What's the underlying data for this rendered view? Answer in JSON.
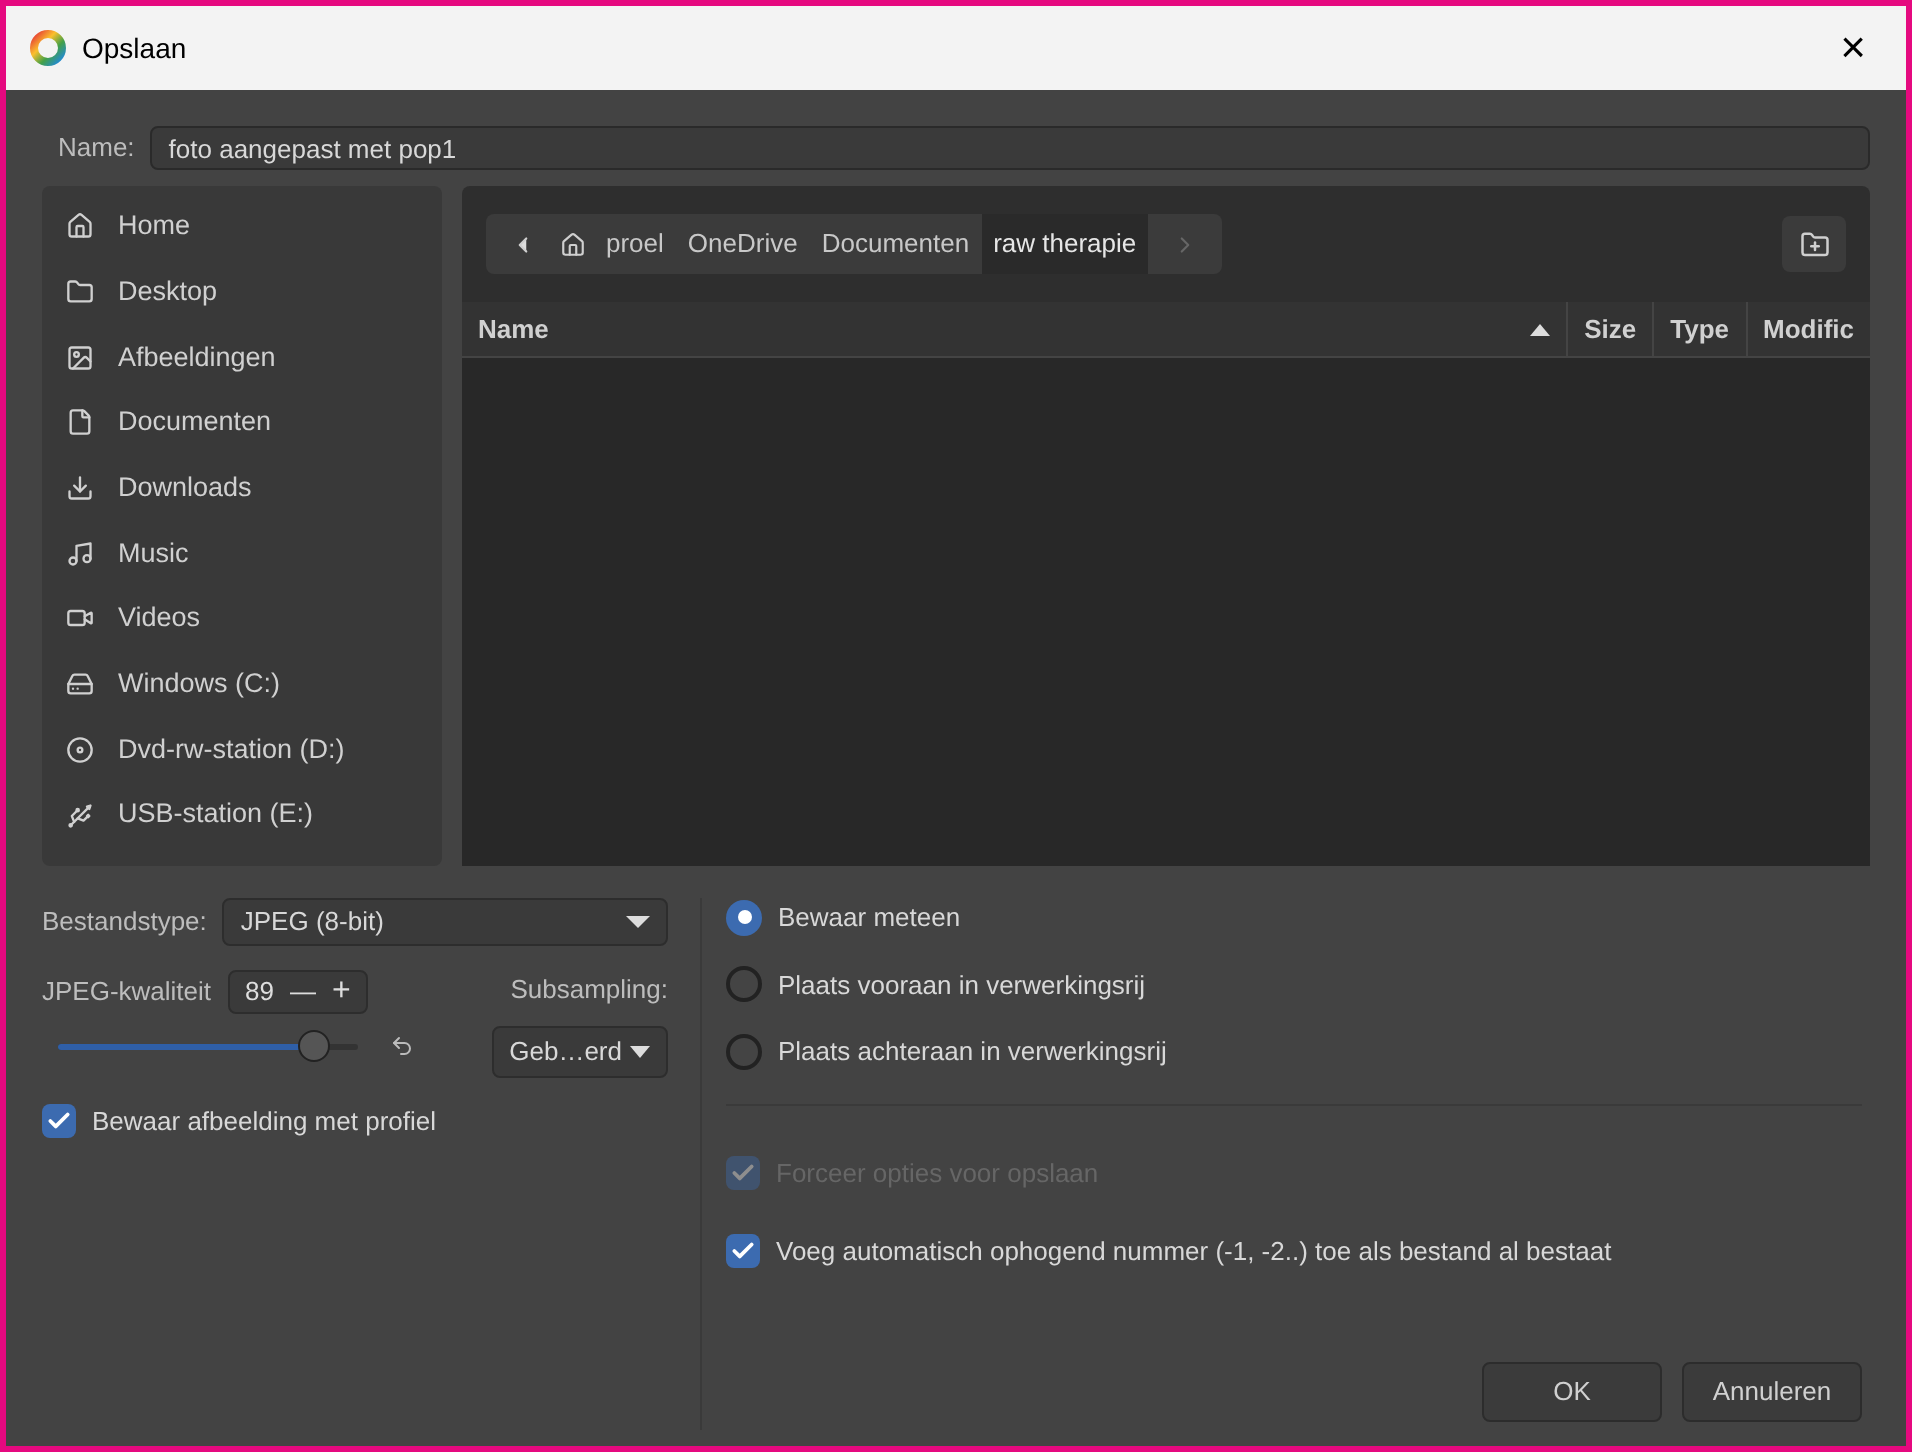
{
  "window": {
    "title": "Opslaan",
    "close": "×"
  },
  "name_field": {
    "label": "Name:",
    "value": "foto aangepast met pop1"
  },
  "places": [
    {
      "label": "Home",
      "kind": "home"
    },
    {
      "label": "Desktop",
      "kind": "folder"
    },
    {
      "label": "Afbeeldingen",
      "kind": "image"
    },
    {
      "label": "Documenten",
      "kind": "document"
    },
    {
      "label": "Downloads",
      "kind": "download"
    },
    {
      "label": "Music",
      "kind": "music"
    },
    {
      "label": "Videos",
      "kind": "video"
    },
    {
      "label": "Windows (C:)",
      "kind": "disk"
    },
    {
      "label": "Dvd-rw-station (D:)",
      "kind": "dvd"
    },
    {
      "label": "USB-station (E:)",
      "kind": "usb"
    }
  ],
  "breadcrumbs": [
    {
      "label": "proel",
      "selected": false
    },
    {
      "label": "OneDrive",
      "selected": false
    },
    {
      "label": "Documenten",
      "selected": false
    },
    {
      "label": "raw therapie",
      "selected": true
    }
  ],
  "table": {
    "columns": [
      {
        "label": "Name",
        "sorted": true
      },
      {
        "label": "Size",
        "sorted": false
      },
      {
        "label": "Type",
        "sorted": false
      },
      {
        "label": "Modific",
        "sorted": false
      }
    ]
  },
  "filetype": {
    "label": "Bestandstype:",
    "value": "JPEG (8-bit)"
  },
  "quality": {
    "label": "JPEG-kwaliteit",
    "value": "89",
    "minus": "—",
    "plus": "+",
    "level": 0.85
  },
  "subsampling": {
    "label": "Subsampling:",
    "value": "Geb…erd"
  },
  "profile_checkbox": {
    "label": "Bewaar afbeelding met profiel",
    "checked": true
  },
  "save_modes": [
    {
      "label": "Bewaar meteen",
      "selected": true
    },
    {
      "label": "Plaats vooraan in verwerkingsrij",
      "selected": false
    },
    {
      "label": "Plaats achteraan in verwerkingsrij",
      "selected": false
    }
  ],
  "options": [
    {
      "label": "Forceer opties voor opslaan",
      "checked": true,
      "disabled": true
    },
    {
      "label": "Voeg automatisch ophogend nummer (-1, -2..) toe als bestand al bestaat",
      "checked": true,
      "disabled": false
    }
  ],
  "buttons": [
    {
      "label": "OK"
    },
    {
      "label": "Annuleren"
    }
  ]
}
